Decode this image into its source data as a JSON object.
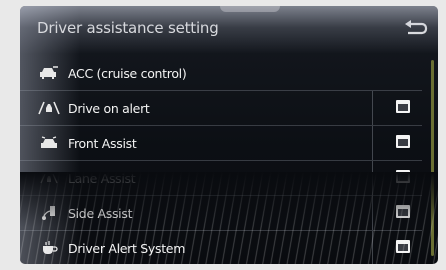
{
  "header": {
    "title": "Driver assistance setting",
    "back_icon": "return-arrow-icon"
  },
  "items": [
    {
      "label": "ACC (cruise control)",
      "icon": "acc-car-icon",
      "has_checkbox": false
    },
    {
      "label": "Drive on alert",
      "icon": "road-alert-icon",
      "has_checkbox": true
    },
    {
      "label": "Front Assist",
      "icon": "front-assist-car-icon",
      "has_checkbox": true
    },
    {
      "label": "Lane Assist",
      "icon": "lane-assist-icon",
      "has_checkbox": true
    },
    {
      "label": "Side Assist",
      "icon": "side-assist-icon",
      "has_checkbox": true
    },
    {
      "label": "Driver Alert System",
      "icon": "coffee-cup-icon",
      "has_checkbox": true
    }
  ],
  "colors": {
    "text": "#f4f4f4",
    "background": "#0c0f14",
    "scrollbar": "#6a6f33"
  }
}
